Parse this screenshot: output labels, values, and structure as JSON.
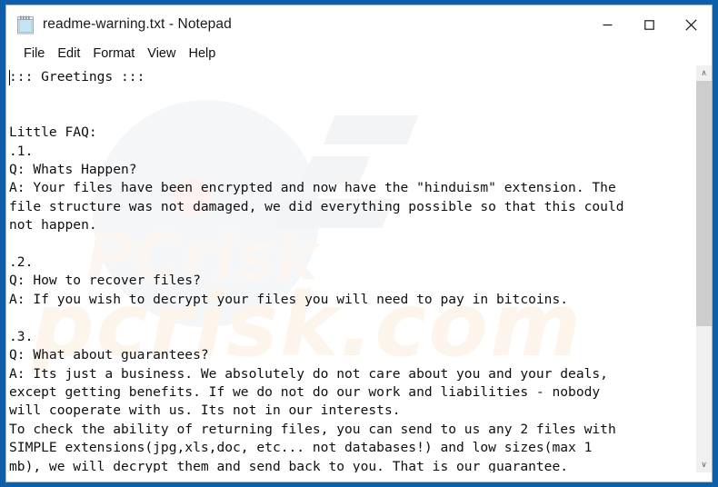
{
  "window": {
    "title": "readme-warning.txt - Notepad",
    "icon": "notepad-icon",
    "controls": {
      "minimize": "‒",
      "maximize": "☐",
      "close": "✕"
    }
  },
  "menu": {
    "items": [
      {
        "label": "File"
      },
      {
        "label": "Edit"
      },
      {
        "label": "Format"
      },
      {
        "label": "View"
      },
      {
        "label": "Help"
      }
    ]
  },
  "editor": {
    "content": "::: Greetings :::\n\n\nLittle FAQ:\n.1.\nQ: Whats Happen?\nA: Your files have been encrypted and now have the \"hinduism\" extension. The\nfile structure was not damaged, we did everything possible so that this could\nnot happen.\n\n.2.\nQ: How to recover files?\nA: If you wish to decrypt your files you will need to pay in bitcoins.\n\n.3.\nQ: What about guarantees?\nA: Its just a business. We absolutely do not care about you and your deals,\nexcept getting benefits. If we do not do our work and liabilities - nobody\nwill cooperate with us. Its not in our interests.\nTo check the ability of returning files, you can send to us any 2 files with\nSIMPLE extensions(jpg,xls,doc, etc... not databases!) and low sizes(max 1\nmb), we will decrypt them and send back to you. That is our guarantee.",
    "watermark_primary": "PCrisk",
    "watermark_secondary": "pcrisk.com"
  },
  "scrollbar": {
    "up_arrow": "∧",
    "down_arrow": "∨"
  },
  "colors": {
    "desktop": "#0c5fa8",
    "window_bg": "#ffffff",
    "text": "#0f0f0f",
    "scroll_thumb": "#cdcdcd",
    "scroll_track": "#f0f0f0"
  }
}
